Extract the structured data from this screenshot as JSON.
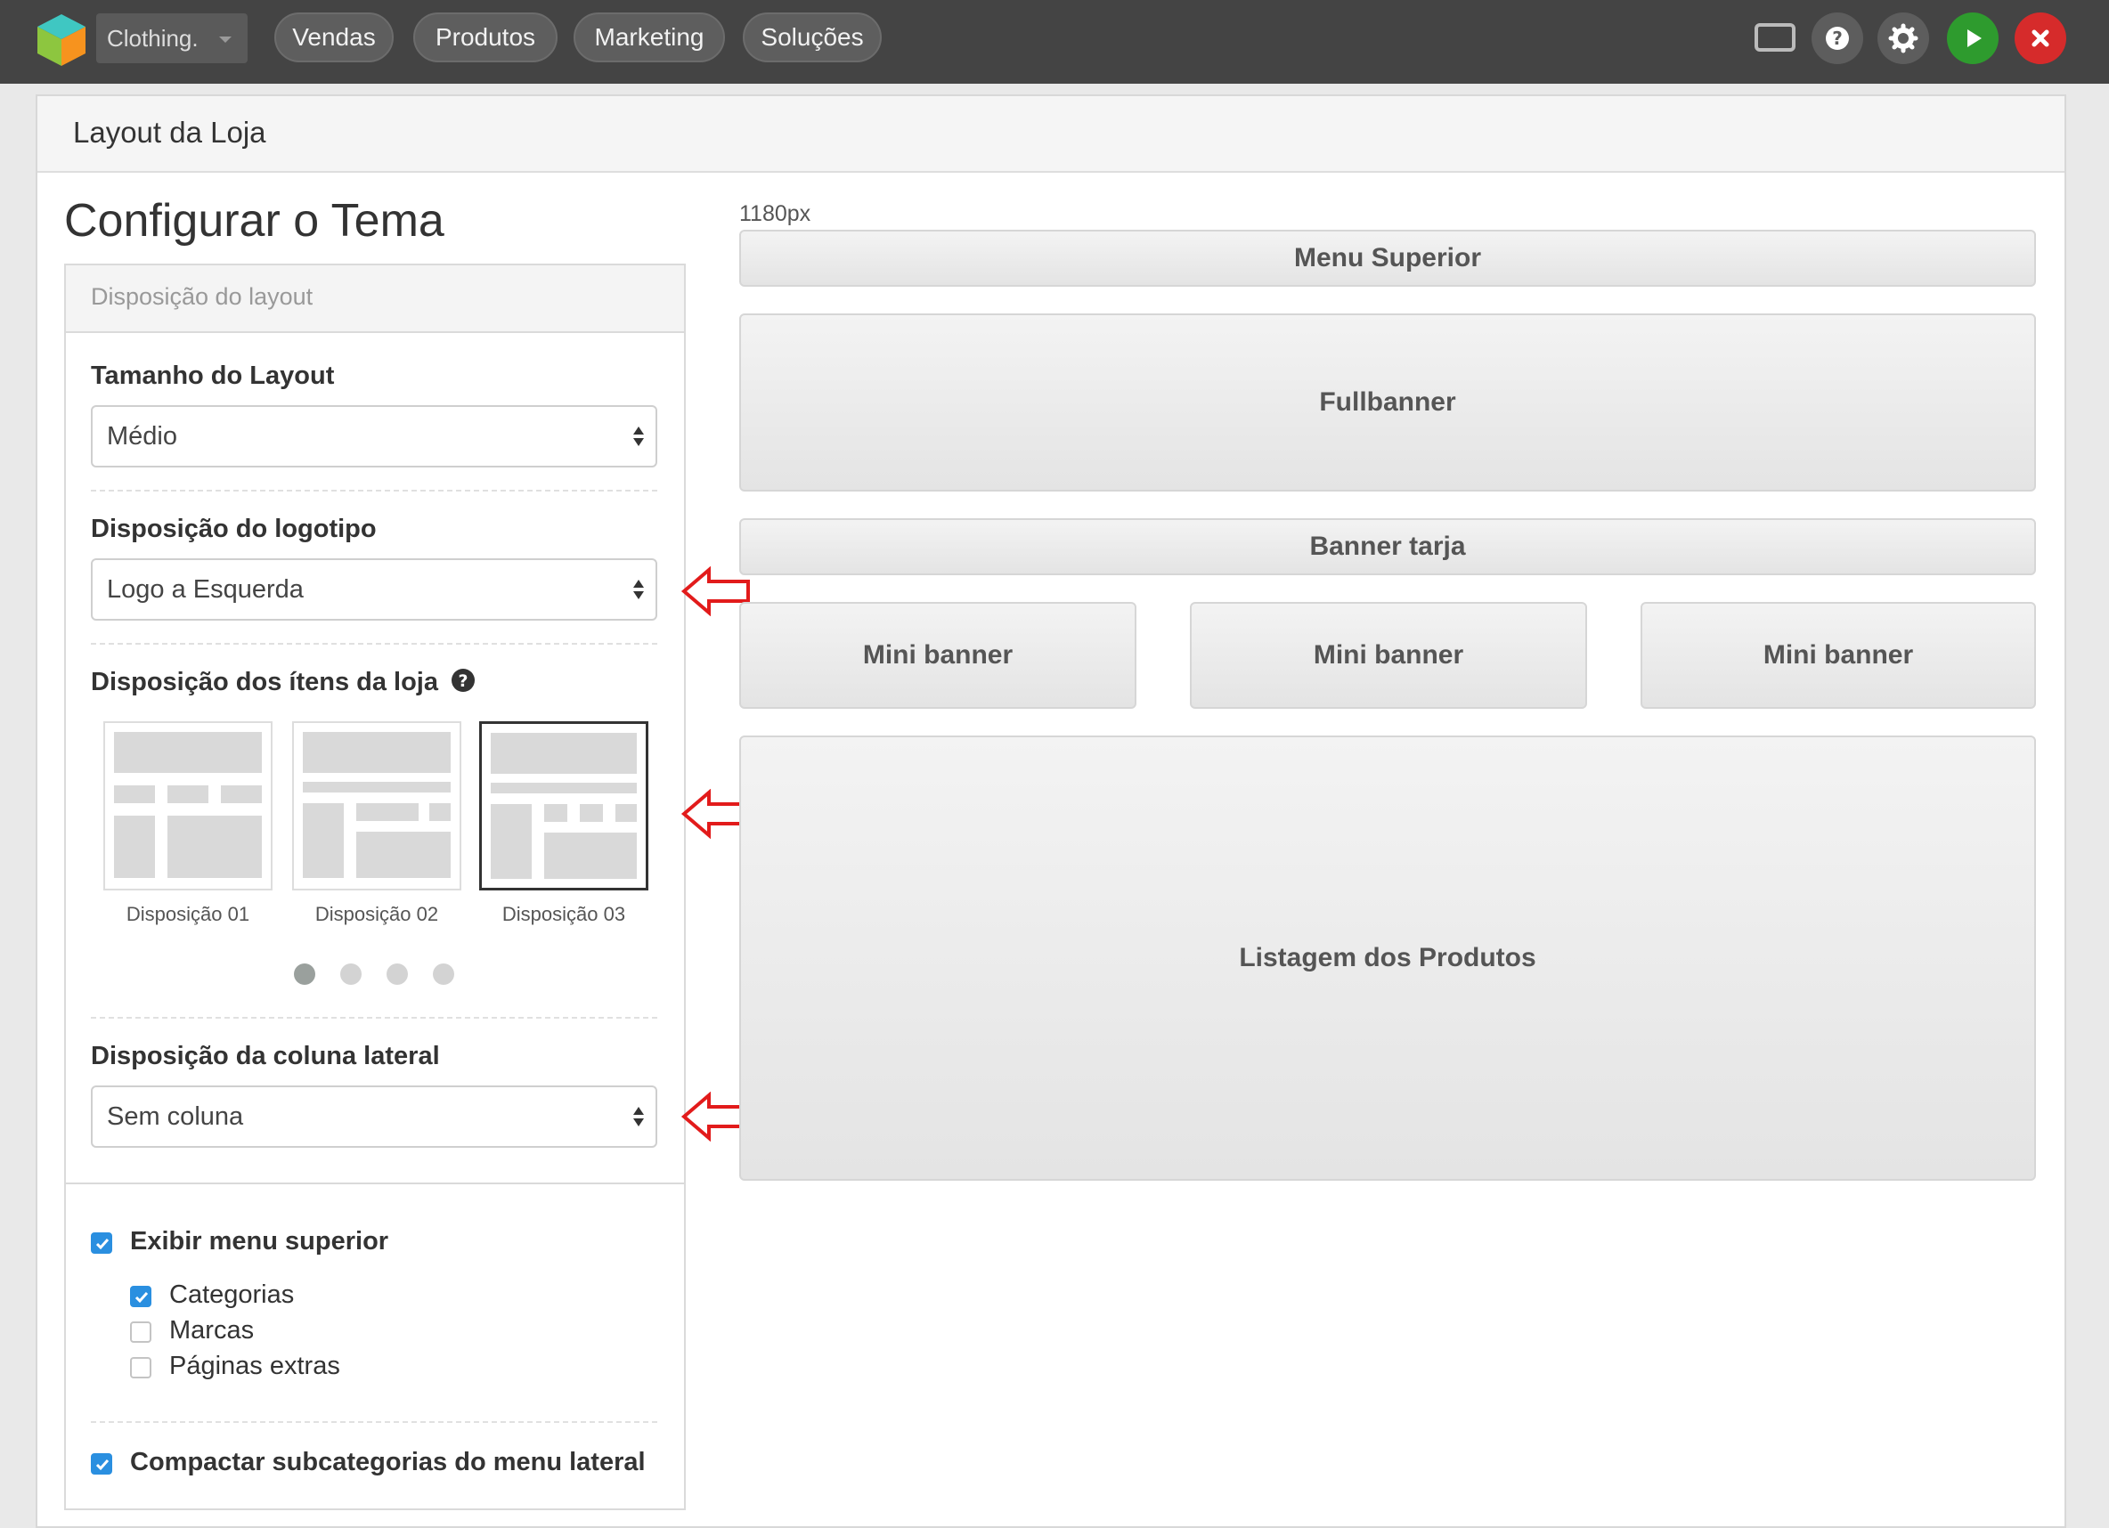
{
  "topbar": {
    "store_name": "Clothing.",
    "nav": [
      "Vendas",
      "Produtos",
      "Marketing",
      "Soluções"
    ],
    "icons": [
      "monitor-icon",
      "help-icon",
      "gear-icon",
      "play-icon",
      "close-icon"
    ],
    "colors": {
      "bar": "#444444",
      "play": "#2e9b2e",
      "close": "#d62b2b"
    }
  },
  "panel": {
    "title": "Layout da Loja"
  },
  "config": {
    "title": "Configurar o Tema",
    "section_title": "Disposição do layout",
    "layout_size": {
      "label": "Tamanho do Layout",
      "value": "Médio"
    },
    "logo_position": {
      "label": "Disposição do logotipo",
      "value": "Logo a Esquerda"
    },
    "items_layout": {
      "label": "Disposição dos ítens da loja",
      "options": [
        "Disposição 01",
        "Disposição 02",
        "Disposição 03"
      ],
      "selected": "Disposição 03",
      "pages": 4,
      "current_page": 1
    },
    "sidebar": {
      "label": "Disposição da coluna lateral",
      "value": "Sem coluna"
    },
    "show_top_menu": {
      "label": "Exibir menu superior",
      "checked": true
    },
    "top_menu_items": [
      {
        "label": "Categorias",
        "checked": true
      },
      {
        "label": "Marcas",
        "checked": false
      },
      {
        "label": "Páginas extras",
        "checked": false
      }
    ],
    "compact_sub": {
      "label": "Compactar subcategorias do menu lateral",
      "checked": true
    }
  },
  "preview": {
    "width_label": "1180px",
    "menu": "Menu Superior",
    "fullbanner": "Fullbanner",
    "banner_tarja": "Banner tarja",
    "mini_banners": [
      "Mini banner",
      "Mini banner",
      "Mini banner"
    ],
    "products": "Listagem dos Produtos"
  }
}
